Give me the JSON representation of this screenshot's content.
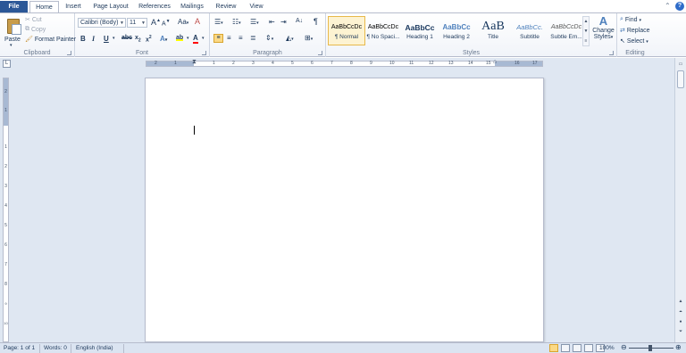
{
  "tabs": {
    "file": "File",
    "home": "Home",
    "insert": "Insert",
    "page_layout": "Page Layout",
    "references": "References",
    "mailings": "Mailings",
    "review": "Review",
    "view": "View"
  },
  "clipboard": {
    "paste": "Paste",
    "cut": "Cut",
    "copy": "Copy",
    "format_painter": "Format Painter",
    "label": "Clipboard"
  },
  "font": {
    "family": "Calibri (Body)",
    "size": "11",
    "grow": "A",
    "shrink": "A",
    "case": "Aa",
    "clear": "A",
    "bold": "B",
    "italic": "I",
    "underline": "U",
    "strikethrough": "abc",
    "subscript": "x",
    "superscript": "x",
    "effects": "A",
    "highlight": "ab",
    "color": "A",
    "label": "Font"
  },
  "paragraph": {
    "sort": "A↓",
    "show_marks": "¶",
    "label": "Paragraph"
  },
  "styles": {
    "label": "Styles",
    "items": [
      {
        "sample": "AaBbCcDc",
        "name": "¶ Normal",
        "color": "#000000"
      },
      {
        "sample": "AaBbCcDc",
        "name": "¶ No Spaci...",
        "color": "#000000"
      },
      {
        "sample": "AaBbCc",
        "name": "Heading 1",
        "color": "#17365d"
      },
      {
        "sample": "AaBbCc",
        "name": "Heading 2",
        "color": "#4f81bd"
      },
      {
        "sample": "AaB",
        "name": "Title",
        "color": "#17365d"
      },
      {
        "sample": "AaBbCc.",
        "name": "Subtitle",
        "color": "#4f81bd"
      },
      {
        "sample": "AaBbCcDc",
        "name": "Subtle Em...",
        "color": "#595959"
      }
    ],
    "change_styles_line1": "Change",
    "change_styles_line2": "Styles"
  },
  "editing": {
    "find": "Find",
    "replace": "Replace",
    "select": "Select",
    "label": "Editing"
  },
  "ruler": {
    "h_numbers": [
      "2",
      "1",
      "1",
      "2",
      "3",
      "4",
      "5",
      "6",
      "7",
      "8",
      "9",
      "10",
      "11",
      "12",
      "13",
      "14",
      "15",
      "16",
      "17",
      "18"
    ],
    "v_numbers": [
      "2",
      "1",
      "1",
      "2",
      "3",
      "4",
      "5",
      "6",
      "7",
      "8",
      "9",
      "10",
      "11",
      "12",
      "13"
    ],
    "corner": "L"
  },
  "status": {
    "page": "Page: 1 of 1",
    "words": "Words: 0",
    "language": "English (India)",
    "zoom": "100%"
  },
  "colors": {
    "file_tab": "#2b5797",
    "accent_text": "#1e395b",
    "background": "#dfe7f2",
    "selected_style_border": "#e8b94a"
  }
}
